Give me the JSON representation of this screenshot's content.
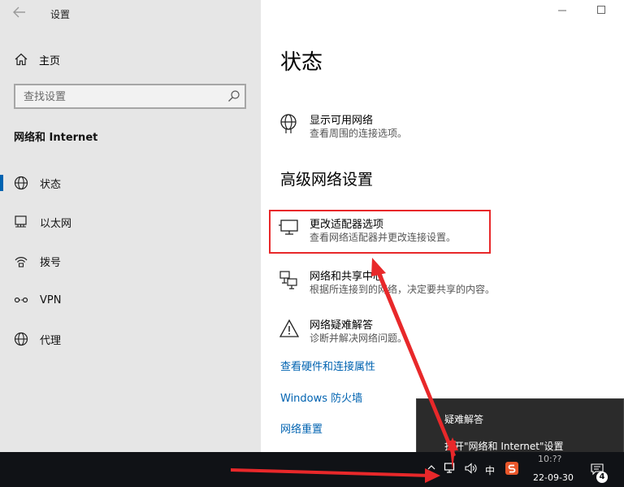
{
  "window": {
    "title": "设置"
  },
  "sidebar": {
    "home_label": "主页",
    "search_placeholder": "查找设置",
    "section_title": "网络和 Internet",
    "items": [
      {
        "label": "状态",
        "icon": "globe-icon",
        "active": true
      },
      {
        "label": "以太网",
        "icon": "ethernet-icon",
        "active": false
      },
      {
        "label": "拨号",
        "icon": "dialup-icon",
        "active": false
      },
      {
        "label": "VPN",
        "icon": "vpn-icon",
        "active": false
      },
      {
        "label": "代理",
        "icon": "globe-icon",
        "active": false
      }
    ]
  },
  "main": {
    "title": "状态",
    "show_networks": {
      "title": "显示可用网络",
      "desc": "查看周围的连接选项。"
    },
    "advanced_title": "高级网络设置",
    "options": [
      {
        "title": "更改适配器选项",
        "desc": "查看网络适配器并更改连接设置。",
        "icon": "adapter-monitor-icon"
      },
      {
        "title": "网络和共享中心",
        "desc": "根据所连接到的网络，决定要共享的内容。",
        "icon": "network-share-icon"
      },
      {
        "title": "网络疑难解答",
        "desc": "诊断并解决网络问题。",
        "icon": "warning-icon"
      }
    ],
    "links": [
      "查看硬件和连接属性",
      "Windows 防火墙",
      "网络重置"
    ]
  },
  "context_menu": {
    "items": [
      "疑难解答",
      "打开\"网络和 Internet\"设置"
    ]
  },
  "taskbar": {
    "ime": "中",
    "time": "10:??",
    "date": "22-09-30",
    "notification_count": "4"
  },
  "colors": {
    "accent": "#0063b1",
    "highlight": "#e8282a",
    "sidebar_bg": "#e6e6e6",
    "taskbar_bg": "#101216"
  }
}
